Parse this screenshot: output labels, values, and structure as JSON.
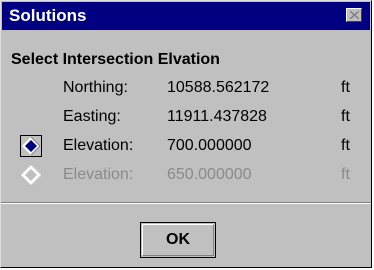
{
  "window": {
    "title": "Solutions"
  },
  "heading": "Select Intersection Elvation",
  "rows": [
    {
      "label": "Northing:",
      "value": "10588.562172",
      "unit": "ft"
    },
    {
      "label": "Easting:",
      "value": "11911.437828",
      "unit": "ft"
    },
    {
      "label": "Elevation:",
      "value": "700.000000",
      "unit": "ft",
      "selected": true,
      "enabled": true
    },
    {
      "label": "Elevation:",
      "value": "650.000000",
      "unit": "ft",
      "selected": false,
      "enabled": false
    }
  ],
  "buttons": {
    "ok_label": "OK"
  },
  "icons": {
    "close": "close-icon",
    "radio_selected": "radio-diamond-selected-icon",
    "radio_unselected": "radio-diamond-unselected-icon"
  },
  "colors": {
    "titlebar": "#000080",
    "face": "#c0c0c0",
    "selected_diamond": "#000080",
    "disabled_text": "#8a8a8a"
  }
}
